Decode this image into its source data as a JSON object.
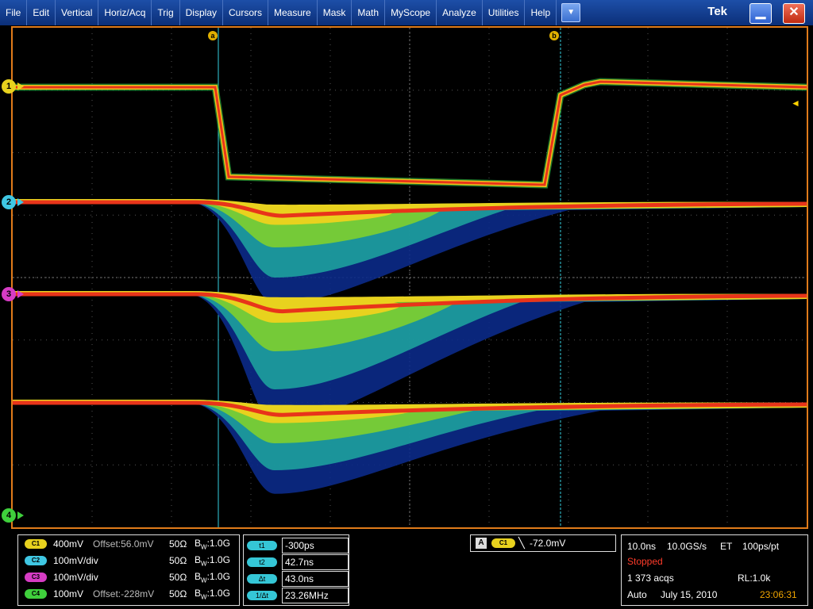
{
  "menu": [
    "File",
    "Edit",
    "Vertical",
    "Horiz/Acq",
    "Trig",
    "Display",
    "Cursors",
    "Measure",
    "Mask",
    "Math",
    "MyScope",
    "Analyze",
    "Utilities",
    "Help"
  ],
  "menu_dropdown_icon": "chevron-down-icon",
  "brand": "Tek",
  "channel_markers": [
    "1",
    "2",
    "3",
    "4"
  ],
  "cursor_labels": {
    "a": "a",
    "b": "b"
  },
  "channels": [
    {
      "pill": "C1",
      "scale": "400mV",
      "offset": "Offset:56.0mV",
      "impedance": "50Ω",
      "bw_prefix": "B",
      "bw_sub": "W",
      "bw_value": ":1.0G",
      "color": "#e8d21e"
    },
    {
      "pill": "C2",
      "scale": "100mV/div",
      "offset": "",
      "impedance": "50Ω",
      "bw_prefix": "B",
      "bw_sub": "W",
      "bw_value": ":1.0G",
      "color": "#3fc7e3"
    },
    {
      "pill": "C3",
      "scale": "100mV/div",
      "offset": "",
      "impedance": "50Ω",
      "bw_prefix": "B",
      "bw_sub": "W",
      "bw_value": ":1.0G",
      "color": "#d63cc4"
    },
    {
      "pill": "C4",
      "scale": "100mV",
      "offset": "Offset:-228mV",
      "impedance": "50Ω",
      "bw_prefix": "B",
      "bw_sub": "W",
      "bw_value": ":1.0G",
      "color": "#3fd03c"
    }
  ],
  "cursors": [
    {
      "pill": "t1",
      "value": "-300ps"
    },
    {
      "pill": "t2",
      "value": "42.7ns"
    },
    {
      "pill": "Δt",
      "value": "43.0ns"
    },
    {
      "pill": "1/Δt",
      "value": "23.26MHz"
    }
  ],
  "trigger": {
    "mode": "A",
    "source": "C1",
    "level": "-72.0mV"
  },
  "acquisition": {
    "horiz_scale": "10.0ns",
    "sample_rate": "10.0GS/s",
    "mode": "ET",
    "resolution": "100ps/pt",
    "status": "Stopped",
    "acqs": "1 373 acqs",
    "record_length": "RL:1.0k",
    "trigger_mode": "Auto",
    "date": "July 15, 2010",
    "time": "23:06:31"
  },
  "colors": {
    "ch1": "#e8d21e",
    "ch2": "#3fc7e3",
    "ch3": "#d63cc4",
    "ch4": "#3fd03c",
    "border": "#e07b1a",
    "cursor": "#33d0e0",
    "stopped": "#ff3b2a",
    "time": "#f0a500"
  }
}
